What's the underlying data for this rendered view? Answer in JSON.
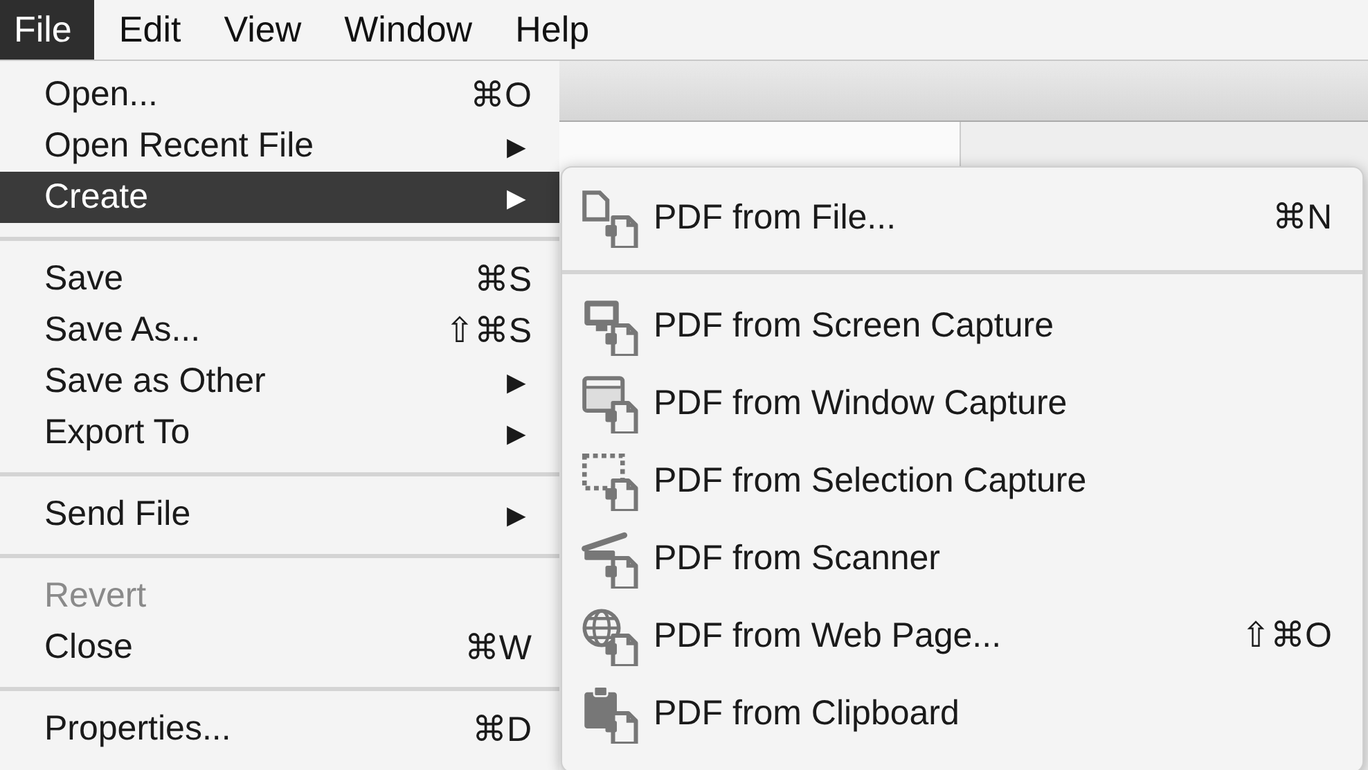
{
  "menubar": [
    {
      "label": "File",
      "selected": true
    },
    {
      "label": "Edit",
      "selected": false
    },
    {
      "label": "View",
      "selected": false
    },
    {
      "label": "Window",
      "selected": false
    },
    {
      "label": "Help",
      "selected": false
    }
  ],
  "file_menu": [
    {
      "kind": "item",
      "label": "Open...",
      "shortcut": "⌘O",
      "selected": false,
      "disabled": false
    },
    {
      "kind": "item",
      "label": "Open Recent File",
      "submenu_arrow": "▶",
      "selected": false,
      "disabled": false
    },
    {
      "kind": "item",
      "label": "Create",
      "submenu_arrow": "▶",
      "selected": true,
      "disabled": false
    },
    {
      "kind": "separator"
    },
    {
      "kind": "item",
      "label": "Save",
      "shortcut": "⌘S",
      "selected": false,
      "disabled": false
    },
    {
      "kind": "item",
      "label": "Save As...",
      "shortcut": "⇧⌘S",
      "selected": false,
      "disabled": false
    },
    {
      "kind": "item",
      "label": "Save as Other",
      "submenu_arrow": "▶",
      "selected": false,
      "disabled": false
    },
    {
      "kind": "item",
      "label": "Export To",
      "submenu_arrow": "▶",
      "selected": false,
      "disabled": false
    },
    {
      "kind": "separator"
    },
    {
      "kind": "item",
      "label": "Send File",
      "submenu_arrow": "▶",
      "selected": false,
      "disabled": false
    },
    {
      "kind": "separator"
    },
    {
      "kind": "item",
      "label": "Revert",
      "selected": false,
      "disabled": true
    },
    {
      "kind": "item",
      "label": "Close",
      "shortcut": "⌘W",
      "selected": false,
      "disabled": false
    },
    {
      "kind": "separator"
    },
    {
      "kind": "item",
      "label": "Properties...",
      "shortcut": "⌘D",
      "selected": false,
      "disabled": false
    }
  ],
  "create_submenu": [
    {
      "kind": "item",
      "label": "PDF from File...",
      "shortcut": "⌘N"
    },
    {
      "kind": "separator"
    },
    {
      "kind": "item",
      "label": "PDF from Screen Capture"
    },
    {
      "kind": "item",
      "label": "PDF from Window Capture"
    },
    {
      "kind": "item",
      "label": "PDF from Selection Capture"
    },
    {
      "kind": "item",
      "label": "PDF from Scanner"
    },
    {
      "kind": "item",
      "label": "PDF from Web Page...",
      "shortcut": "⇧⌘O"
    },
    {
      "kind": "item",
      "label": "PDF from Clipboard"
    }
  ]
}
